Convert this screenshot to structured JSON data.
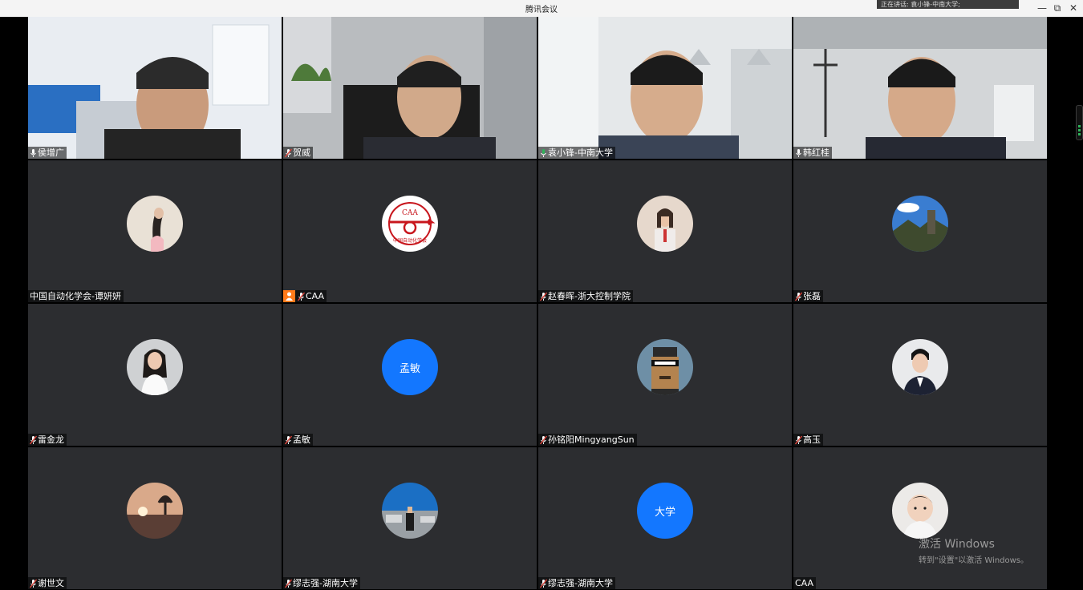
{
  "window": {
    "title": "腾讯会议",
    "notice": "正在讲话: 袁小锋-中南大学;",
    "minimize": "—",
    "restore": "⧉",
    "close": "✕"
  },
  "tiles": [
    {
      "name": "侯增广",
      "mic": "on",
      "kind": "video"
    },
    {
      "name": "贺威",
      "mic": "muted",
      "kind": "video"
    },
    {
      "name": "袁小锋-中南大学",
      "mic": "on",
      "kind": "video",
      "speaking": true
    },
    {
      "name": "韩红桂",
      "mic": "on",
      "kind": "video"
    },
    {
      "name": "中国自动化学会-谭妍妍",
      "mic": "none",
      "kind": "avatar"
    },
    {
      "name": "CAA",
      "mic": "muted",
      "kind": "avatar",
      "host": true
    },
    {
      "name": "赵春晖-浙大控制学院",
      "mic": "muted",
      "kind": "avatar"
    },
    {
      "name": "张磊",
      "mic": "muted",
      "kind": "avatar"
    },
    {
      "name": "雷金龙",
      "mic": "muted",
      "kind": "avatar"
    },
    {
      "name": "孟敏",
      "mic": "muted",
      "kind": "text-avatar",
      "avatar_text": "孟敏"
    },
    {
      "name": "孙铭阳MingyangSun",
      "mic": "muted",
      "kind": "avatar"
    },
    {
      "name": "高玉",
      "mic": "muted",
      "kind": "avatar"
    },
    {
      "name": "谢世文",
      "mic": "muted",
      "kind": "avatar"
    },
    {
      "name": "缪志强-湖南大学",
      "mic": "muted",
      "kind": "avatar"
    },
    {
      "name": "缪志强-湖南大学",
      "mic": "muted",
      "kind": "text-avatar",
      "avatar_text": "大学"
    },
    {
      "name": "CAA",
      "mic": "none",
      "kind": "avatar"
    }
  ],
  "caa_logo": {
    "top": "CAA",
    "ring": "中国自动化学会"
  },
  "watermark": {
    "line1": "激活 Windows",
    "line2": "转到\"设置\"以激活 Windows。"
  },
  "colors": {
    "accent": "#1377ff",
    "speaking": "#2fb45a",
    "tile_bg": "#2c2d30",
    "host_badge": "#ff7a1a",
    "mic_muted": "#e0463c"
  }
}
